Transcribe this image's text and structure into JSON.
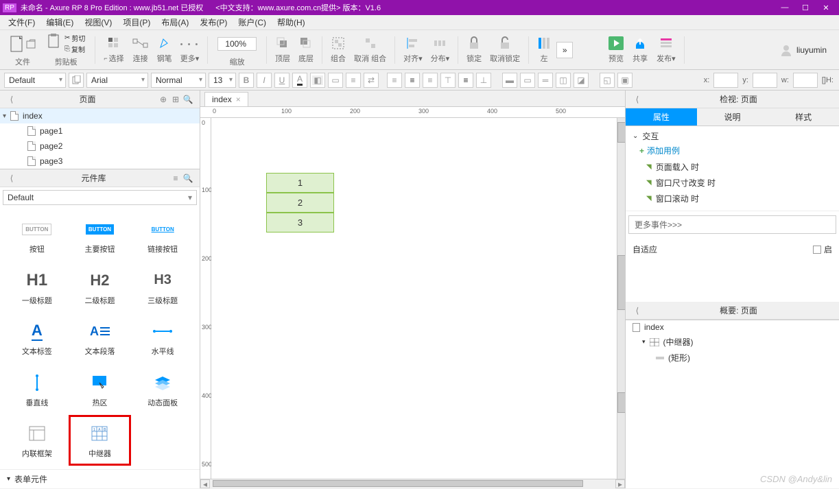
{
  "title": {
    "app_badge": "RP",
    "doc": "未命名 - Axure RP 8 Pro Edition : www.jb51.net 已授权",
    "extra": "<中文支持：www.axure.com.cn提供> 版本：V1.6"
  },
  "window_controls": {
    "min": "—",
    "max": "☐",
    "close": "✕"
  },
  "menubar": [
    "文件(F)",
    "编辑(E)",
    "视图(V)",
    "项目(P)",
    "布局(A)",
    "发布(P)",
    "账户(C)",
    "帮助(H)"
  ],
  "toolbar": {
    "file_label": "文件",
    "clipboard_label": "剪贴板",
    "cut": "剪切",
    "copy": "复制",
    "select": "选择",
    "connect": "连接",
    "pen": "钢笔",
    "more": "更多▾",
    "zoom_value": "100%",
    "zoom_label": "缩放",
    "front": "顶层",
    "back": "底层",
    "group": "组合",
    "ungroup": "取消 组合",
    "align": "对齐▾",
    "distribute": "分布▾",
    "lock": "锁定",
    "unlock": "取消锁定",
    "left": "左",
    "preview": "预览",
    "share": "共享",
    "publish": "发布▾",
    "user": "liuyumin"
  },
  "formatbar": {
    "style": "Default",
    "font": "Arial",
    "weight": "Normal",
    "size": "13",
    "coords": {
      "x": "x:",
      "y": "y:",
      "w": "w:",
      "lh": "[]H:"
    }
  },
  "left": {
    "pages_title": "页面",
    "pages": [
      "index",
      "page1",
      "page2",
      "page3"
    ],
    "lib_title": "元件库",
    "lib_default": "Default",
    "widgets": [
      {
        "id": "button",
        "label": "按钮",
        "icon": "BUTTON",
        "style": "border:1px solid #ccc;font-size:8px;padding:3px 4px;color:#999;"
      },
      {
        "id": "primary-button",
        "label": "主要按钮",
        "icon": "BUTTON",
        "style": "background:#0099ff;color:#fff;font-size:8px;padding:3px 4px;"
      },
      {
        "id": "link-button",
        "label": "链接按钮",
        "icon": "BUTTON",
        "style": "color:#0099ff;font-size:8px;text-decoration:underline;"
      },
      {
        "id": "h1",
        "label": "一级标题",
        "icon": "H1",
        "style": "font-size:24px;color:#555;"
      },
      {
        "id": "h2",
        "label": "二级标题",
        "icon": "H2",
        "style": "font-size:22px;color:#555;"
      },
      {
        "id": "h3",
        "label": "三级标题",
        "icon": "H3",
        "style": "font-size:20px;color:#555;"
      },
      {
        "id": "text-label",
        "label": "文本标签",
        "icon": "A_",
        "style": "color:#0066cc;font-size:20px;"
      },
      {
        "id": "paragraph",
        "label": "文本段落",
        "icon": "A≡",
        "style": "color:#0066cc;font-size:18px;"
      },
      {
        "id": "hr",
        "label": "水平线",
        "icon": "—",
        "style": "color:#0099ff;letter-spacing:-1px;"
      },
      {
        "id": "vr",
        "label": "垂直线",
        "icon": "|",
        "style": "color:#0099ff;font-size:20px;"
      },
      {
        "id": "hotspot",
        "label": "热区",
        "icon": "hot",
        "style": ""
      },
      {
        "id": "dynamic-panel",
        "label": "动态面板",
        "icon": "stack",
        "style": ""
      },
      {
        "id": "iframe",
        "label": "内联框架",
        "icon": "iframe",
        "style": ""
      },
      {
        "id": "repeater",
        "label": "中继器",
        "icon": "grid",
        "style": ""
      }
    ],
    "accordion": "表单元件"
  },
  "canvas": {
    "tab": "index",
    "ruler_h": [
      "0",
      "100",
      "200",
      "300",
      "400",
      "500"
    ],
    "ruler_v": [
      "0",
      "100",
      "200",
      "300",
      "400",
      "500"
    ],
    "cells": [
      "1",
      "2",
      "3"
    ]
  },
  "right": {
    "inspect_title": "检视: 页面",
    "tabs": [
      "属性",
      "说明",
      "样式"
    ],
    "interaction": "交互",
    "add_case": "添加用例",
    "events": [
      "页面载入 时",
      "窗口尺寸改变 时",
      "窗口滚动 时"
    ],
    "more_events": "更多事件>>>",
    "adaptive": "自适应",
    "adaptive_enable": "启",
    "outline_title": "概要: 页面",
    "outline": [
      {
        "lvl": 0,
        "icon": "page",
        "label": "index"
      },
      {
        "lvl": 1,
        "icon": "repeater",
        "label": "(中继器)"
      },
      {
        "lvl": 2,
        "icon": "text",
        "label": "(矩形)"
      }
    ]
  },
  "watermark": "CSDN @Andy&lin"
}
